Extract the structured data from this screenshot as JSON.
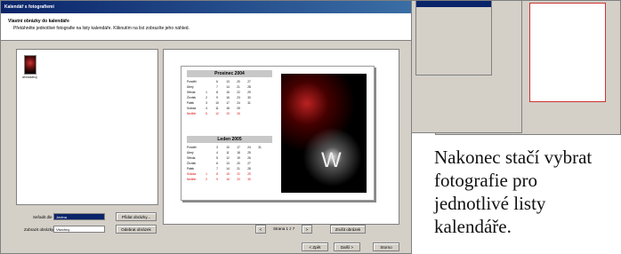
{
  "window": {
    "title": "Kalendář s fotografiemi",
    "heading": "Vlastní obrázky do kalendáře",
    "subheading": "Přetáhněte jednotlivé fotografie na listy kalendáře. Kliknutím na list zobrazíte jeho náhled."
  },
  "thumbs": [
    {
      "label": "ohnostroj"
    }
  ],
  "calendar": {
    "months": [
      {
        "title": "Prosinec 2004",
        "rows": [
          {
            "day": "Pondělí",
            "nums": [
              "",
              "6",
              "13",
              "20",
              "27"
            ],
            "red": false
          },
          {
            "day": "Úterý",
            "nums": [
              "",
              "7",
              "14",
              "21",
              "28"
            ],
            "red": false
          },
          {
            "day": "Středa",
            "nums": [
              "1",
              "8",
              "15",
              "22",
              "29"
            ],
            "red": false
          },
          {
            "day": "Čtvrtek",
            "nums": [
              "2",
              "9",
              "16",
              "23",
              "30"
            ],
            "red": false
          },
          {
            "day": "Pátek",
            "nums": [
              "3",
              "10",
              "17",
              "24",
              "31"
            ],
            "red": false
          },
          {
            "day": "Sobota",
            "nums": [
              "4",
              "11",
              "18",
              "25",
              ""
            ],
            "red": false
          },
          {
            "day": "Neděle",
            "nums": [
              "5",
              "12",
              "19",
              "26",
              ""
            ],
            "red": true
          }
        ]
      },
      {
        "title": "Leden 2005",
        "rows": [
          {
            "day": "Pondělí",
            "nums": [
              "",
              "3",
              "10",
              "17",
              "24",
              "31"
            ],
            "red": false
          },
          {
            "day": "Úterý",
            "nums": [
              "",
              "4",
              "11",
              "18",
              "25",
              ""
            ],
            "red": false
          },
          {
            "day": "Středa",
            "nums": [
              "",
              "5",
              "12",
              "19",
              "26",
              ""
            ],
            "red": false
          },
          {
            "day": "Čtvrtek",
            "nums": [
              "",
              "6",
              "13",
              "20",
              "27",
              ""
            ],
            "red": false
          },
          {
            "day": "Pátek",
            "nums": [
              "",
              "7",
              "14",
              "21",
              "28",
              ""
            ],
            "red": false
          },
          {
            "day": "Sobota",
            "nums": [
              "1",
              "8",
              "15",
              "22",
              "29",
              ""
            ],
            "red": true
          },
          {
            "day": "Neděle",
            "nums": [
              "2",
              "9",
              "16",
              "23",
              "30",
              ""
            ],
            "red": true
          }
        ]
      }
    ]
  },
  "controls": {
    "sort_label": "Seřadit dle",
    "sort_value": "Jména",
    "filter_label": "Zobrazit obrázky",
    "filter_value": "Všechny",
    "btn_add": "Přidat obrázky...",
    "btn_remove": "Odebrat obrázek",
    "page_label": "Strana 1 z 7",
    "prev": "<",
    "next": ">",
    "btn_clear": "Zrušit obrázek",
    "btn_back": "< Zpět",
    "btn_next": "Další >",
    "btn_cancel": "Storno"
  },
  "caption": "Nakonec stačí vybrat fotografie pro jednotlivé listy kalendáře."
}
